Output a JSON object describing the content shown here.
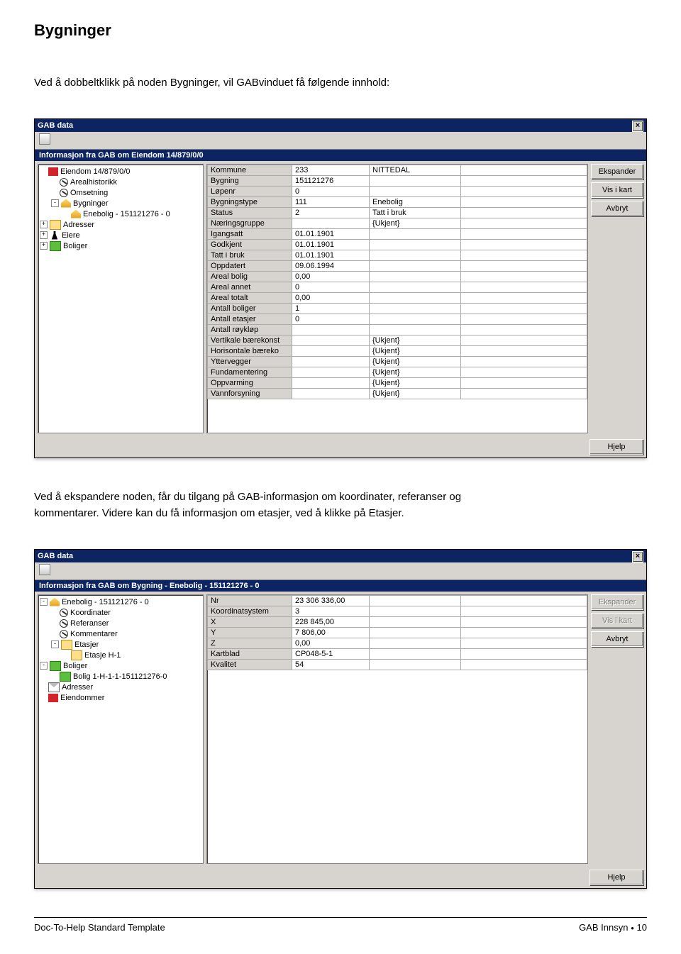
{
  "doc": {
    "heading": "Bygninger",
    "para1": "Ved å dobbeltklikk på noden Bygninger, vil GABvinduet få følgende innhold:",
    "para2a": "Ved å ekspandere noden, får du tilgang på GAB-informasjon om koordinater, referanser og",
    "para2b": "kommentarer. Videre kan du få informasjon om etasjer, ved å klikke på Etasjer."
  },
  "footer": {
    "left": "Doc-To-Help Standard Template",
    "right_a": "GAB Innsyn",
    "right_b": "10"
  },
  "win1": {
    "title": "GAB data",
    "infobar": "Informasjon fra GAB om Eiendom 14/879/0/0",
    "buttons": {
      "ekspander": "Ekspander",
      "viskart": "Vis i kart",
      "avbryt": "Avbryt",
      "hjelp": "Hjelp"
    },
    "tree": [
      {
        "indent": 0,
        "exp": "",
        "icon": "ic-red",
        "label": "Eiendom 14/879/0/0"
      },
      {
        "indent": 1,
        "exp": "",
        "icon": "ic-circle",
        "label": "Arealhistorikk"
      },
      {
        "indent": 1,
        "exp": "",
        "icon": "ic-circle",
        "label": "Omsetning"
      },
      {
        "indent": 1,
        "exp": "-",
        "icon": "ic-house",
        "label": "Bygninger"
      },
      {
        "indent": 2,
        "exp": "",
        "icon": "ic-house",
        "label": "Enebolig - 151121276 - 0"
      },
      {
        "indent": 0,
        "exp": "+",
        "icon": "ic-folder",
        "label": "Adresser"
      },
      {
        "indent": 0,
        "exp": "+",
        "icon": "ic-person",
        "label": "Eiere"
      },
      {
        "indent": 0,
        "exp": "+",
        "icon": "ic-vbar",
        "label": "Boliger"
      }
    ],
    "rows": [
      {
        "k": "Kommune",
        "v1": "233",
        "v2": "NITTEDAL"
      },
      {
        "k": "Bygning",
        "v1": "151121276",
        "v2": ""
      },
      {
        "k": "Løpenr",
        "v1": "0",
        "v2": ""
      },
      {
        "k": "Bygningstype",
        "v1": "111",
        "v2": "Enebolig"
      },
      {
        "k": "Status",
        "v1": "2",
        "v2": "Tatt i bruk"
      },
      {
        "k": "Næringsgruppe",
        "v1": "",
        "v2": "{Ukjent}"
      },
      {
        "k": "Igangsatt",
        "v1": "01.01.1901",
        "v2": ""
      },
      {
        "k": "Godkjent",
        "v1": "01.01.1901",
        "v2": ""
      },
      {
        "k": "Tatt i bruk",
        "v1": "01.01.1901",
        "v2": ""
      },
      {
        "k": "Oppdatert",
        "v1": "09.06.1994",
        "v2": ""
      },
      {
        "k": "Areal bolig",
        "v1": "0,00",
        "v2": ""
      },
      {
        "k": "Areal annet",
        "v1": "0",
        "v2": ""
      },
      {
        "k": "Areal totalt",
        "v1": "0,00",
        "v2": ""
      },
      {
        "k": "Antall boliger",
        "v1": "1",
        "v2": ""
      },
      {
        "k": "Antall etasjer",
        "v1": "0",
        "v2": ""
      },
      {
        "k": "Antall røykløp",
        "v1": "",
        "v2": ""
      },
      {
        "k": "Vertikale bærekonst",
        "v1": "",
        "v2": "{Ukjent}"
      },
      {
        "k": "Horisontale bæreko",
        "v1": "",
        "v2": "{Ukjent}"
      },
      {
        "k": "Yttervegger",
        "v1": "",
        "v2": "{Ukjent}"
      },
      {
        "k": "Fundamentering",
        "v1": "",
        "v2": "{Ukjent}"
      },
      {
        "k": "Oppvarming",
        "v1": "",
        "v2": "{Ukjent}"
      },
      {
        "k": "Vannforsyning",
        "v1": "",
        "v2": "{Ukjent}"
      }
    ]
  },
  "win2": {
    "title": "GAB data",
    "infobar": "Informasjon fra GAB om Bygning - Enebolig - 151121276 - 0",
    "buttons": {
      "ekspander": "Ekspander",
      "viskart": "Vis i kart",
      "avbryt": "Avbryt",
      "hjelp": "Hjelp"
    },
    "tree": [
      {
        "indent": 0,
        "exp": "-",
        "icon": "ic-house",
        "label": "Enebolig - 151121276 - 0"
      },
      {
        "indent": 1,
        "exp": "",
        "icon": "ic-circle",
        "label": "Koordinater"
      },
      {
        "indent": 1,
        "exp": "",
        "icon": "ic-circle",
        "label": "Referanser"
      },
      {
        "indent": 1,
        "exp": "",
        "icon": "ic-circle",
        "label": "Kommentarer"
      },
      {
        "indent": 1,
        "exp": "-",
        "icon": "ic-folder",
        "label": "Etasjer"
      },
      {
        "indent": 2,
        "exp": "",
        "icon": "ic-folder",
        "label": "Etasje H-1"
      },
      {
        "indent": 0,
        "exp": "-",
        "icon": "ic-vbar",
        "label": "Boliger"
      },
      {
        "indent": 1,
        "exp": "",
        "icon": "ic-vbar",
        "label": "Bolig 1-H-1-1-151121276-0"
      },
      {
        "indent": 0,
        "exp": "",
        "icon": "ic-env",
        "label": "Adresser"
      },
      {
        "indent": 0,
        "exp": "",
        "icon": "ic-red",
        "label": "Eiendommer"
      }
    ],
    "rows": [
      {
        "k": "Nr",
        "v1": "23 306 336,00",
        "v2": ""
      },
      {
        "k": "Koordinatsystem",
        "v1": "3",
        "v2": ""
      },
      {
        "k": "X",
        "v1": "228 845,00",
        "v2": ""
      },
      {
        "k": "Y",
        "v1": "7 806,00",
        "v2": ""
      },
      {
        "k": "Z",
        "v1": "0,00",
        "v2": ""
      },
      {
        "k": "Kartblad",
        "v1": "CP048-5-1",
        "v2": ""
      },
      {
        "k": "Kvalitet",
        "v1": "54",
        "v2": ""
      }
    ]
  }
}
